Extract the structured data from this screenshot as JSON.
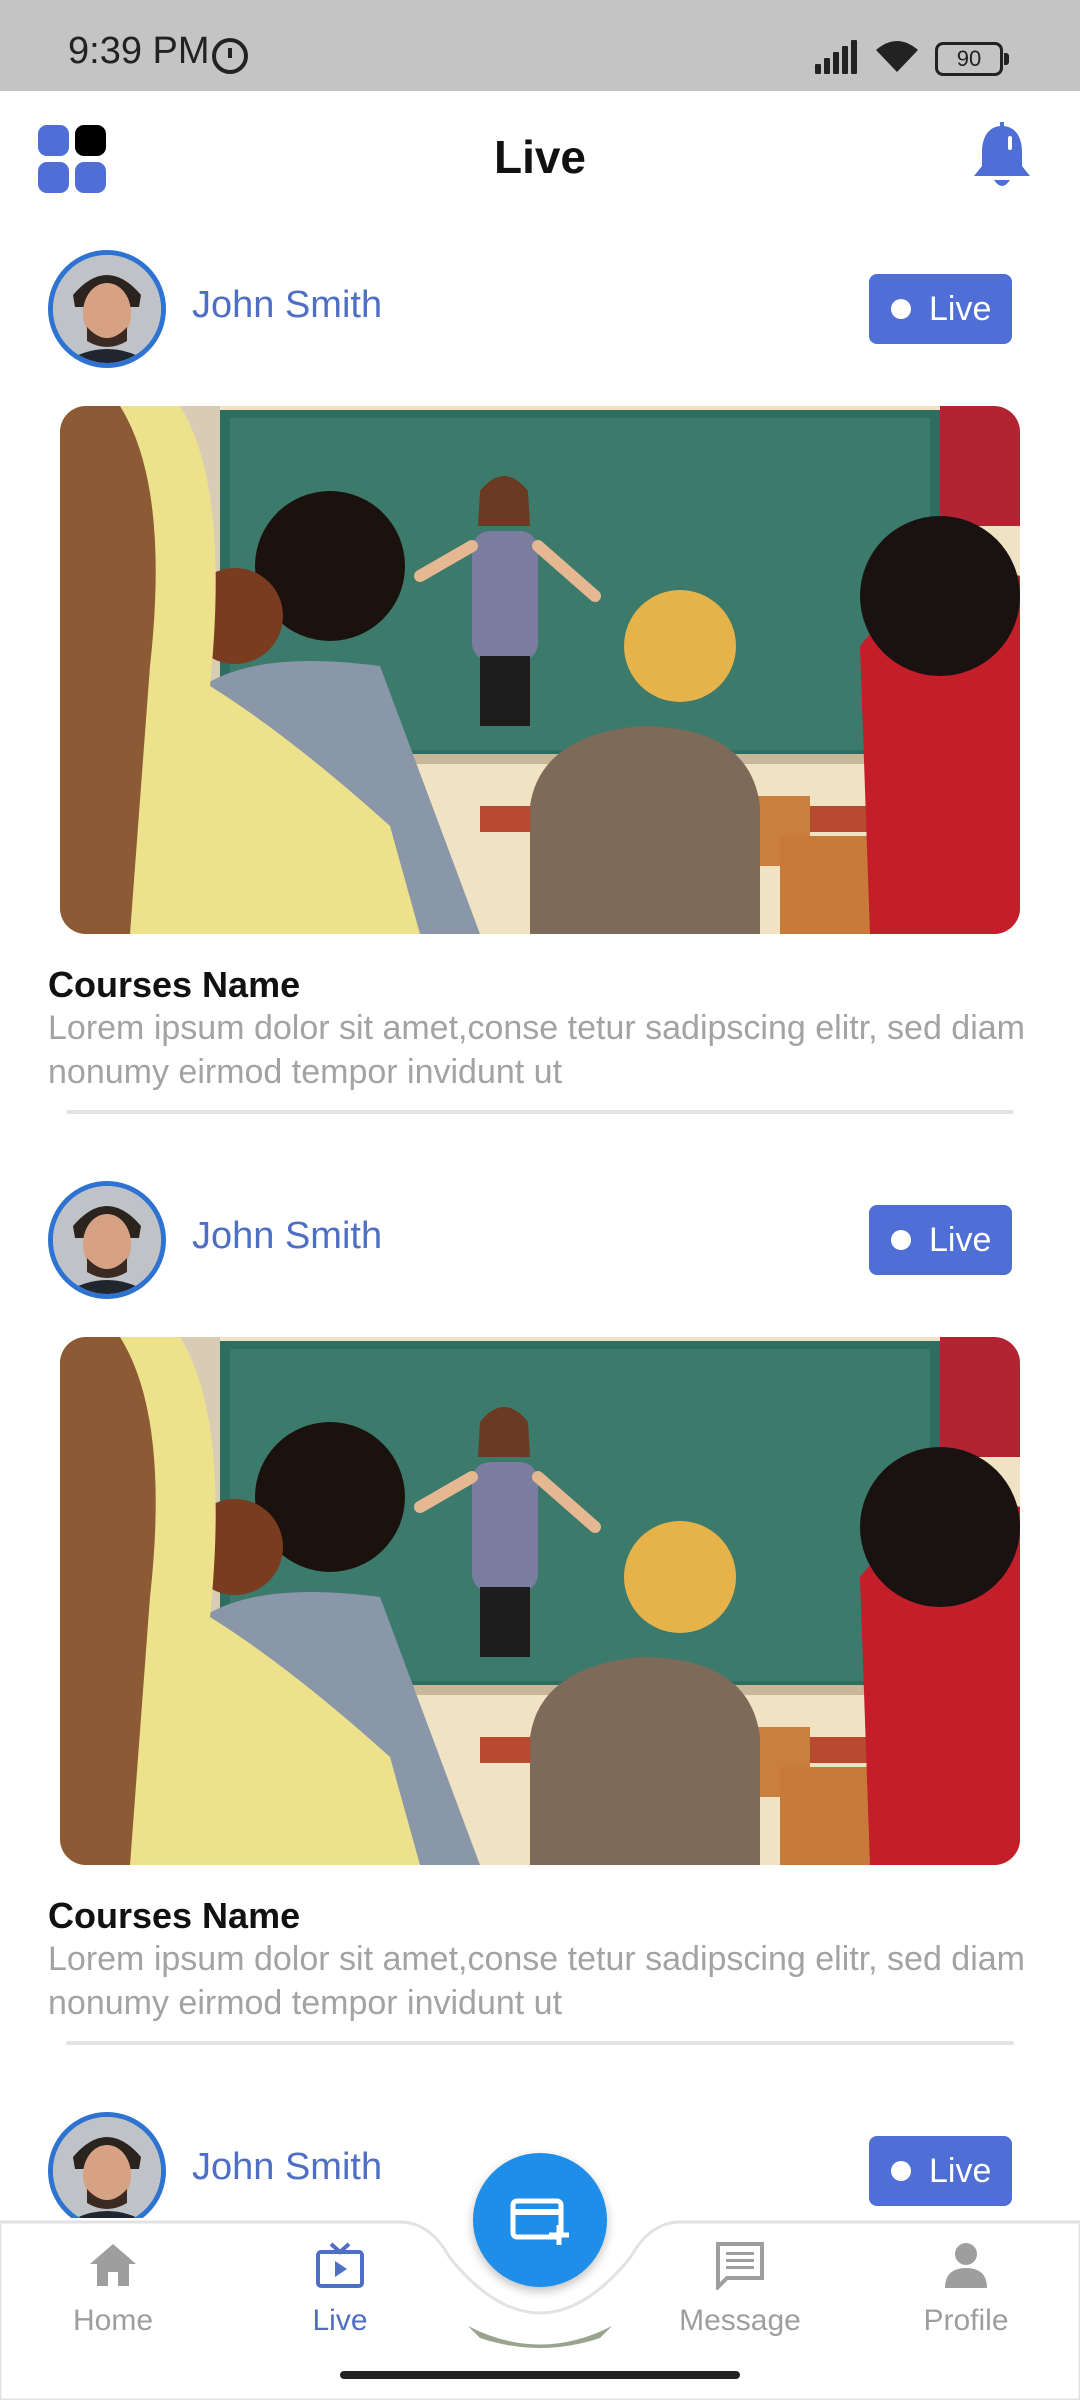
{
  "status_bar": {
    "time": "9:39 PM",
    "battery": "90"
  },
  "header": {
    "title": "Live"
  },
  "feed": [
    {
      "user_name": "John Smith",
      "live_label": "Live",
      "course_title": "Courses Name",
      "course_description": "Lorem ipsum dolor sit amet,conse tetur sadipscing elitr, sed diam nonumy eirmod tempor invidunt ut"
    },
    {
      "user_name": "John Smith",
      "live_label": "Live",
      "course_title": "Courses Name",
      "course_description": "Lorem ipsum dolor sit amet,conse tetur sadipscing elitr, sed diam nonumy eirmod tempor invidunt ut"
    },
    {
      "user_name": "John Smith",
      "live_label": "Live"
    }
  ],
  "bottom_nav": {
    "items": [
      {
        "label": "Home",
        "icon": "home-icon",
        "active": false
      },
      {
        "label": "Live",
        "icon": "tv-icon",
        "active": true
      },
      {
        "label": "Message",
        "icon": "message-icon",
        "active": false
      },
      {
        "label": "Profile",
        "icon": "profile-icon",
        "active": false
      }
    ],
    "fab_icon": "add-card-icon"
  },
  "colors": {
    "accent": "#4F6FD6",
    "fab": "#1E8EE8",
    "nav_inactive": "#9E9E9E",
    "avatar_ring": "#2E73D1"
  }
}
